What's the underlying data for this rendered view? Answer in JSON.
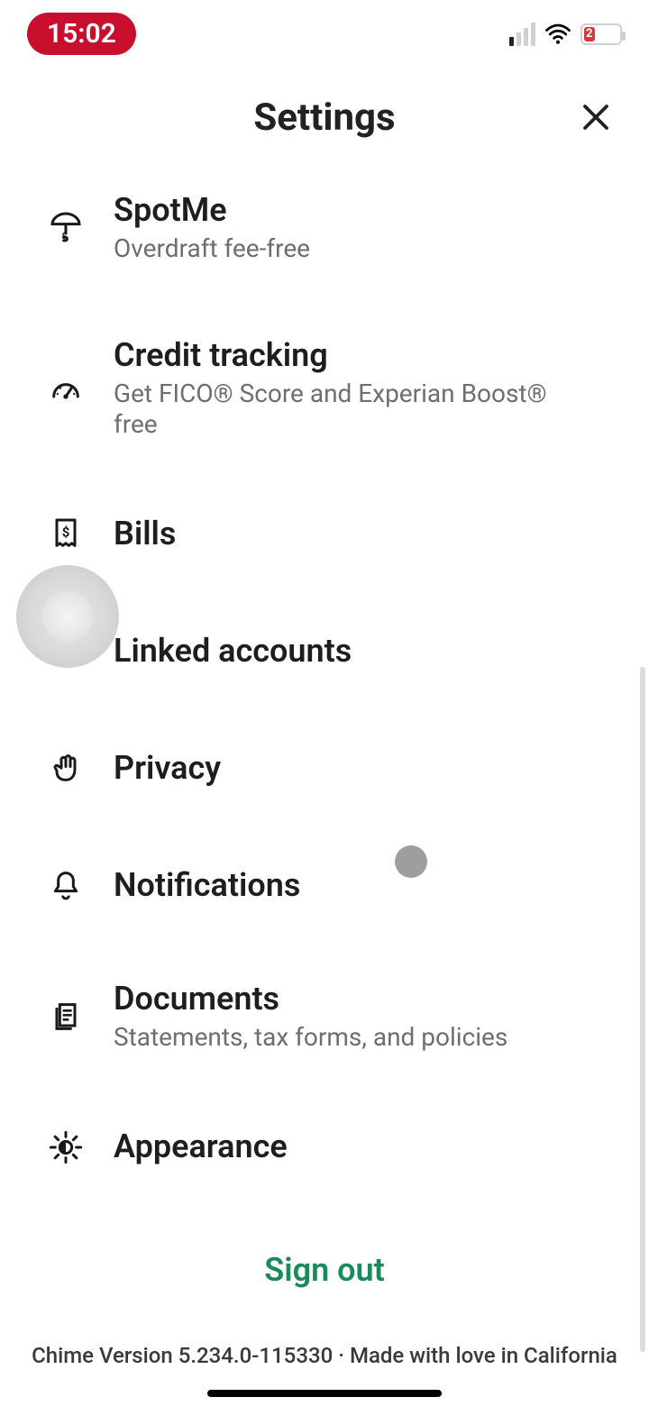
{
  "status": {
    "time": "15:02",
    "battery_text": "2"
  },
  "header": {
    "title": "Settings"
  },
  "items": [
    {
      "id": "spotme",
      "title": "SpotMe",
      "subtitle": "Overdraft fee-free",
      "icon": "umbrella-dollar"
    },
    {
      "id": "credit",
      "title": "Credit tracking",
      "subtitle": "Get FICO® Score and Experian Boost® free",
      "icon": "gauge"
    },
    {
      "id": "bills",
      "title": "Bills",
      "subtitle": "",
      "icon": "receipt-dollar"
    },
    {
      "id": "linked",
      "title": "Linked accounts",
      "subtitle": "",
      "icon": "bank"
    },
    {
      "id": "privacy",
      "title": "Privacy",
      "subtitle": "",
      "icon": "hand"
    },
    {
      "id": "notifications",
      "title": "Notifications",
      "subtitle": "",
      "icon": "bell"
    },
    {
      "id": "documents",
      "title": "Documents",
      "subtitle": "Statements, tax forms, and policies",
      "icon": "document"
    },
    {
      "id": "appearance",
      "title": "Appearance",
      "subtitle": "",
      "icon": "brightness"
    }
  ],
  "sign_out_label": "Sign out",
  "footer": "Chime Version 5.234.0-115330 · Made with love in California",
  "colors": {
    "accent": "#1a8a5a",
    "time_bg": "#c8102e"
  }
}
